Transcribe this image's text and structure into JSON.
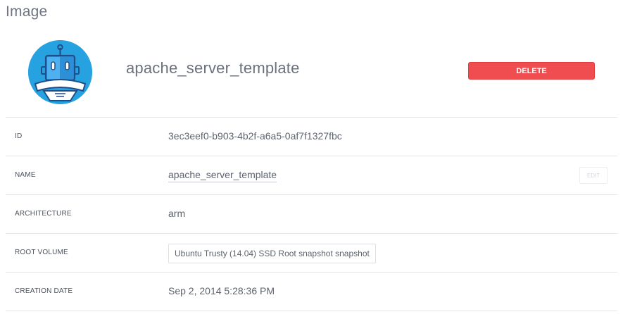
{
  "header": {
    "title": "Image"
  },
  "image": {
    "avatar_icon": "robot-icon",
    "name": "apache_server_template",
    "delete_label": "DELETE",
    "colors": {
      "avatar_bg": "#27a2e0",
      "delete_bg": "#ef4d50"
    }
  },
  "details": {
    "id": {
      "label": "ID",
      "value": "3ec3eef0-b903-4b2f-a6a5-0af7f1327fbc"
    },
    "name": {
      "label": "NAME",
      "value": "apache_server_template",
      "edit_label": "EDIT"
    },
    "architecture": {
      "label": "ARCHITECTURE",
      "value": "arm"
    },
    "root_volume": {
      "label": "ROOT VOLUME",
      "value": "Ubuntu Trusty (14.04) SSD Root snapshot snapshot"
    },
    "creation_date": {
      "label": "CREATION DATE",
      "value": "Sep 2, 2014 5:28:36 PM"
    }
  }
}
